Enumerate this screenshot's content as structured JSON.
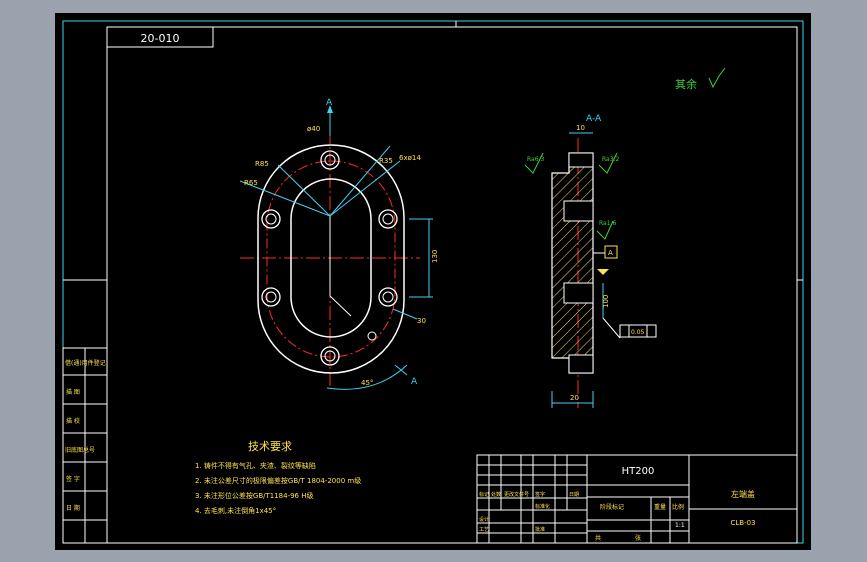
{
  "drawing": {
    "code_box": "20-010",
    "roughness_note": "其余",
    "section_label": "A-A",
    "view_markers": [
      "A",
      "A"
    ],
    "tech_req_title": "技术要求",
    "tech_req_lines": [
      "1. 铸件不得有气孔、夹渣、裂纹等缺陷",
      "2. 未注公差尺寸的极限偏差按GB/T 1804-2000 m级",
      "3. 未注形位公差按GB/T1184-96 H级",
      "4. 去毛刺,未注倒角1x45°"
    ],
    "dims_main": [
      "R35",
      "R65",
      "R85",
      "6xø14",
      "ø40",
      "130",
      "30",
      "45°"
    ],
    "dims_section": [
      "Ra6.3",
      "Ra3.2",
      "Ra1.6",
      "20",
      "10",
      "100",
      "A",
      "0.05"
    ],
    "side_labels": [
      "借(通)用件登记",
      "描 图",
      "描 校",
      "旧底图总号",
      "签 字",
      "日 期"
    ],
    "title_block": {
      "material": "HT200",
      "part_name": "左端盖",
      "drawing_no": "CLB-03",
      "scale": "1:1",
      "stage_label": "阶段标记",
      "weight_label": "重量",
      "scale_label": "比例",
      "sheet_label": "共",
      "sheet_of": "张",
      "designer_label": "设计",
      "standard_label": "标准化",
      "process_label": "工艺",
      "approve_label": "批准",
      "rev_labels": [
        "标记",
        "处数",
        "更改文件号",
        "签字",
        "日期"
      ]
    }
  },
  "colors": {
    "frame": "#ffffff",
    "border": "#44d0f0",
    "part": "#ffffff",
    "centerline": "#ff2a2a",
    "dimension": "#44d0f0",
    "hatch": "#ffe14a",
    "text_yellow": "#ffe14a",
    "text_green": "#3bd23b"
  }
}
